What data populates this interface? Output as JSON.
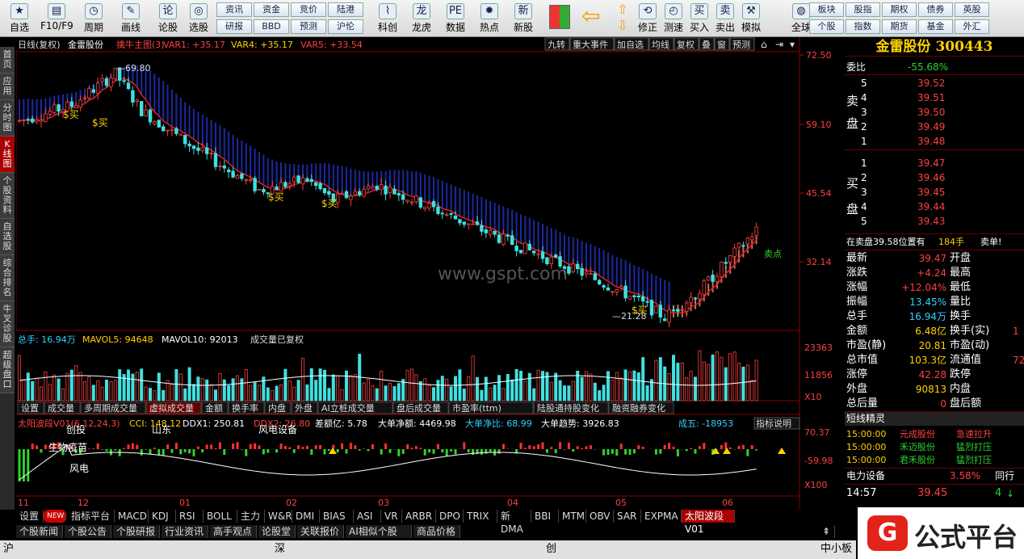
{
  "toolbar": {
    "buttons": [
      {
        "label": "自选",
        "icon": "star-icon"
      },
      {
        "label": "F10/F9",
        "icon": "f10-icon"
      },
      {
        "label": "周期",
        "icon": "clock-icon"
      },
      {
        "label": "画线",
        "icon": "pen-icon"
      },
      {
        "label": "论股",
        "icon": "discuss-icon"
      },
      {
        "label": "选股",
        "icon": "select-icon"
      }
    ],
    "grid_top": [
      "资讯",
      "资金",
      "竞价",
      "陆港"
    ],
    "grid_bottom": [
      "研报",
      "BBD",
      "预测",
      "沪伦"
    ],
    "buttons2": [
      {
        "label": "科创",
        "icon": "chart-icon"
      },
      {
        "label": "龙虎",
        "icon": "dragon-icon"
      },
      {
        "label": "数据",
        "icon": "pe-icon"
      },
      {
        "label": "热点",
        "icon": "hot-icon"
      },
      {
        "label": "新股",
        "icon": "ipo-icon"
      }
    ],
    "buttons3": [
      {
        "label": "修正",
        "icon": "fix-icon"
      },
      {
        "label": "测速",
        "icon": "speed-icon"
      },
      {
        "label": "买入",
        "icon": "buy-icon"
      },
      {
        "label": "卖出",
        "icon": "sell-icon"
      },
      {
        "label": "模拟",
        "icon": "hammer-icon"
      },
      {
        "label": "全球",
        "icon": "globe-icon"
      }
    ],
    "grid2_top": [
      "板块",
      "股指",
      "期权",
      "债券",
      "英股"
    ],
    "grid2_bottom": [
      "个股",
      "指数",
      "期货",
      "基金",
      "外汇"
    ],
    "buy_glyph": "买",
    "sell_glyph": "卖",
    "pe_glyph": "PE"
  },
  "leftnav": [
    "首页",
    "应用",
    "分时图",
    "K线图",
    "个股资料",
    "自选股",
    "综合排名",
    "牛叉诊股",
    "超级盘口"
  ],
  "chart_header": {
    "mode": "日线(复权)",
    "name": "金雷股份",
    "ind": "擒牛主图(3)",
    "var1": "VAR1: +35.17",
    "var4": "VAR4: +35.17",
    "var5": "VAR5: +33.54"
  },
  "chart_tools": [
    "九转",
    "重大事件",
    "加自选",
    "均线",
    "复权",
    "叠",
    "窗",
    "预测"
  ],
  "price_axis": [
    "72.50",
    "59.10",
    "45.54",
    "32.14"
  ],
  "labels": {
    "high": "69.80",
    "low": "21.28",
    "buy": "$买",
    "sell_pt": "卖点",
    "watermark": "www.gspt.com"
  },
  "vol_header": {
    "total": "总手: 16.94万",
    "mavol5": "MAVOL5: 94648",
    "mavol10": "MAVOL10: 92013",
    "note": "成交量已复权"
  },
  "vol_axis": [
    "23363",
    "11856",
    "X10"
  ],
  "vol_tabs": [
    "设置",
    "成交量",
    "多周期成交量",
    "虚拟成交量",
    "金额",
    "换手率",
    "内盘",
    "外盘",
    "AI立桩成交量",
    "盘后成交量",
    "市盈率(ttm)",
    "陆股通持股变化",
    "融资融券变化"
  ],
  "ind_header": {
    "name": "太阳波段V01(6,12,24,3)",
    "cci": "CCI: 148.12",
    "ddx1": "DDX1: 250.81",
    "ddx2": "DDX2: 26.80",
    "diff": "差额亿: 5.78",
    "big": "大单净额: 4469.98",
    "bigr": "大单净比: 68.99",
    "trend": "大单趋势: 3926.83",
    "five": "成五: -18953",
    "explain": "指标说明"
  },
  "ind_labels": [
    "创投",
    "山东",
    "风电设备",
    "生物疫苗",
    "风电"
  ],
  "ind_axis": [
    "70.37",
    "-59.98",
    "X100"
  ],
  "dates": [
    "11",
    "12",
    "01",
    "02",
    "03",
    "04",
    "05",
    "06"
  ],
  "ind_tabs": [
    "设置",
    "NEW",
    "指标平台",
    "MACD",
    "KDJ",
    "RSI",
    "BOLL",
    "主力",
    "W&R",
    "DMI",
    "BIAS",
    "ASI",
    "VR",
    "ARBR",
    "DPO",
    "TRIX",
    "新DMA",
    "BBI",
    "MTM",
    "OBV",
    "SAR",
    "EXPMA",
    "太阳波段V01"
  ],
  "news_tabs": [
    "个股新闻",
    "个股公告",
    "个股研报",
    "行业资讯",
    "高手观点",
    "论股堂",
    "关联报价",
    "AI相似个股",
    "商品价格"
  ],
  "status": [
    "沪",
    "深",
    "创",
    "中小板"
  ],
  "quote": {
    "title": "金雷股份 300443",
    "webi_label": "委比",
    "webi": "-55.68%",
    "sell_label": [
      "卖",
      "盘"
    ],
    "buy_label": [
      "买",
      "盘"
    ],
    "asks": [
      [
        "5",
        "39.52"
      ],
      [
        "4",
        "39.51"
      ],
      [
        "3",
        "39.50"
      ],
      [
        "2",
        "39.49"
      ],
      [
        "1",
        "39.48"
      ]
    ],
    "bids": [
      [
        "1",
        "39.47"
      ],
      [
        "2",
        "39.46"
      ],
      [
        "3",
        "39.45"
      ],
      [
        "4",
        "39.44"
      ],
      [
        "5",
        "39.43"
      ]
    ],
    "note": "在卖盘39.58位置有",
    "note_vol": "184手",
    "note_tail": "卖单!",
    "stats": [
      [
        "最新",
        "39.47",
        "开盘",
        ""
      ],
      [
        "涨跌",
        "+4.24",
        "最高",
        ""
      ],
      [
        "涨幅",
        "+12.04%",
        "最低",
        ""
      ],
      [
        "振幅",
        "13.45%",
        "量比",
        ""
      ],
      [
        "总手",
        "16.94万",
        "换手",
        ""
      ],
      [
        "金额",
        "6.48亿",
        "换手(实)",
        "1"
      ],
      [
        "市盈(静)",
        "20.81",
        "市盈(动)",
        ""
      ],
      [
        "总市值",
        "103.3亿",
        "流通值",
        "72"
      ],
      [
        "涨停",
        "42.28",
        "跌停",
        ""
      ],
      [
        "外盘",
        "90813",
        "内盘",
        ""
      ],
      [
        "总后量",
        "0",
        "盘后额",
        ""
      ]
    ],
    "short_title": "短线精灵",
    "short": [
      [
        "15:00:00",
        "元成股份",
        "急速拉升"
      ],
      [
        "15:00:00",
        "禾迈股份",
        "猛烈打压"
      ],
      [
        "15:00:00",
        "君禾股份",
        "猛烈打压"
      ]
    ],
    "sector": "电力设备",
    "sector_pct": "3.58%",
    "sector_more": "同行",
    "tick_time": "14:57",
    "tick_price": "39.45",
    "tick_vol": "4"
  },
  "logo": {
    "text": "公式平台",
    "mark": "G"
  },
  "chart_data": {
    "type": "candlestick",
    "price_high": 69.8,
    "price_low": 21.28,
    "last_close": 39.47,
    "ylim": [
      21.28,
      72.5
    ]
  }
}
